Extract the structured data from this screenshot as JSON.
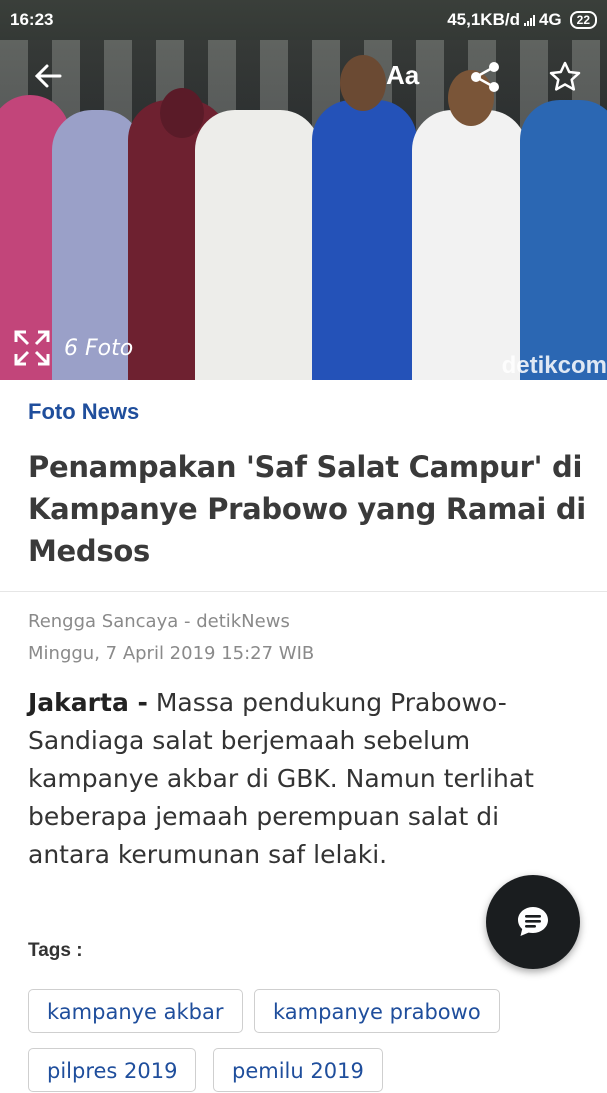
{
  "status_bar": {
    "time": "16:23",
    "network_speed": "45,1KB/d",
    "network_type": "4G",
    "battery": "22"
  },
  "toolbar": {
    "text_size_label": "Aa",
    "icons": [
      "back-arrow-icon",
      "share-icon",
      "star-icon"
    ]
  },
  "photo": {
    "count_label": "6 Foto",
    "watermark": "detikcom"
  },
  "article": {
    "category": "Foto News",
    "title": "Penampakan 'Saf Salat Campur' di Kampanye Prabowo yang Ramai di Medsos",
    "author": "Rengga Sancaya - detikNews",
    "date": "Minggu, 7 April 2019 15:27 WIB",
    "location": "Jakarta -",
    "body": "Massa pendukung Prabowo-Sandiaga salat berjemaah sebelum kampanye akbar di GBK. Namun terlihat beberapa jemaah perempuan salat di antara kerumunan saf lelaki."
  },
  "tags": {
    "label": "Tags :",
    "items": [
      "kampanye akbar",
      "kampanye prabowo",
      "pilpres 2019",
      "pemilu 2019"
    ]
  },
  "colors": {
    "accent": "#1f4e9c",
    "fab": "#1a1d1f"
  }
}
